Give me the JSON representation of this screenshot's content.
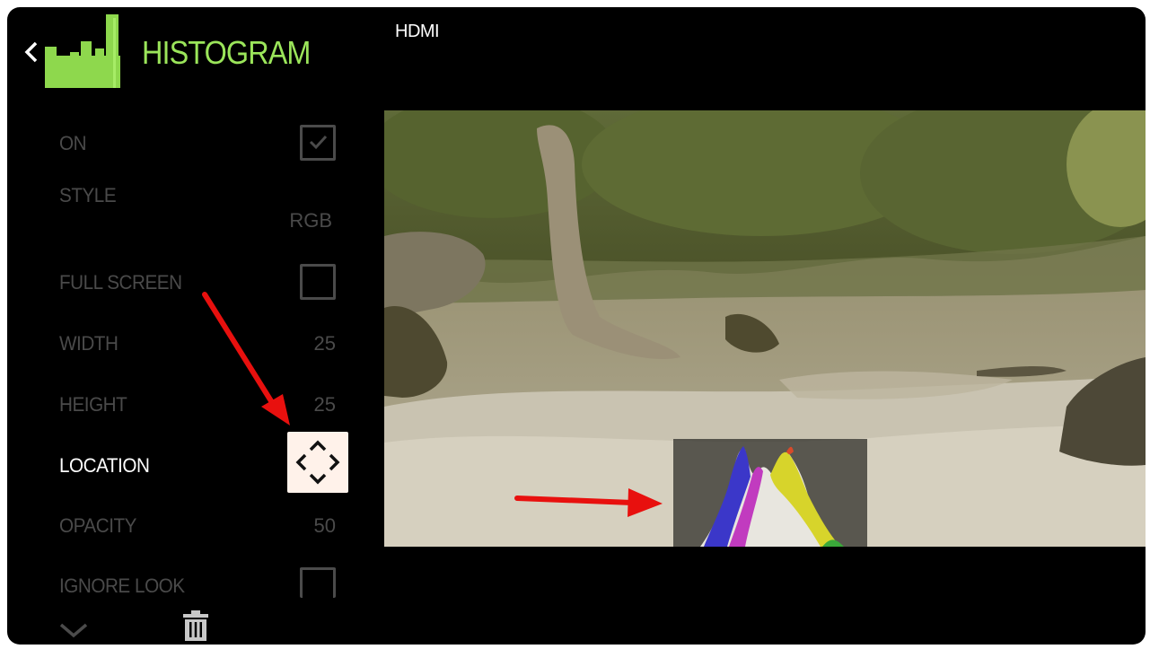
{
  "header": {
    "title": "HISTOGRAM",
    "source": "HDMI"
  },
  "menu": {
    "on": {
      "label": "ON",
      "checked": true
    },
    "style": {
      "label": "STYLE",
      "value": "RGB"
    },
    "full_screen": {
      "label": "FULL SCREEN",
      "checked": false
    },
    "width": {
      "label": "WIDTH",
      "value": "25"
    },
    "height": {
      "label": "HEIGHT",
      "value": "25"
    },
    "location": {
      "label": "LOCATION",
      "icon": "move-icon",
      "active": true
    },
    "opacity": {
      "label": "OPACITY",
      "value": "50"
    },
    "ignore_look": {
      "label": "IGNORE LOOK",
      "checked": false
    }
  },
  "footer": {
    "icons": [
      "chevron-down-icon",
      "trash-icon"
    ]
  },
  "colors": {
    "accent": "#9be55a",
    "inactive_text": "#4a4a4a",
    "active_text": "#ffffff",
    "background": "#000000",
    "annotation_arrow": "#e8100e",
    "location_button_bg": "#fff2ea"
  }
}
